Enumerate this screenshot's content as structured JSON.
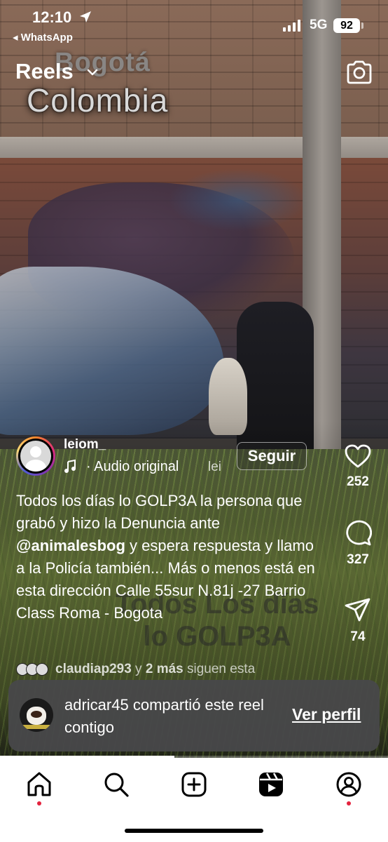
{
  "status_bar": {
    "time": "12:10",
    "back_app": "◂ WhatsApp",
    "network": "5G",
    "battery": "92"
  },
  "header": {
    "title": "Reels"
  },
  "video_overlay": {
    "place_line1": "Bogotá",
    "place_line2": "Colombia",
    "caption_line1": "Todos Los días",
    "caption_line2": "lo GOLP3A"
  },
  "actions": {
    "likes": "252",
    "comments": "327",
    "shares": "74"
  },
  "post": {
    "username": "leiom_",
    "audio": "· Audio original",
    "audio_next": "lei",
    "follow_label": "Seguir",
    "caption_part1": "Todos los días lo GOLP3A la persona que grabó y hizo la Denuncia ante ",
    "caption_mention": "@animalesbog",
    "caption_part2": " y espera respuesta y llamo a la Policía también... Más o menos está en esta dirección Calle 55sur N.81j -27 Barrio Class Roma - Bogota"
  },
  "followers": {
    "user": "claudiap293",
    "connector": " y ",
    "more": "2 más",
    "suffix": " siguen esta"
  },
  "share_toast": {
    "message": "adricar45 compartió este reel contigo",
    "action": "Ver perfil"
  },
  "progress_fraction": 0.45,
  "colors": {
    "nav_dot": "#e4233e",
    "toast_bg": "#48484a"
  },
  "nav": {
    "items": [
      "home-icon",
      "search-icon",
      "create-icon",
      "reels-icon",
      "profile-icon"
    ]
  }
}
